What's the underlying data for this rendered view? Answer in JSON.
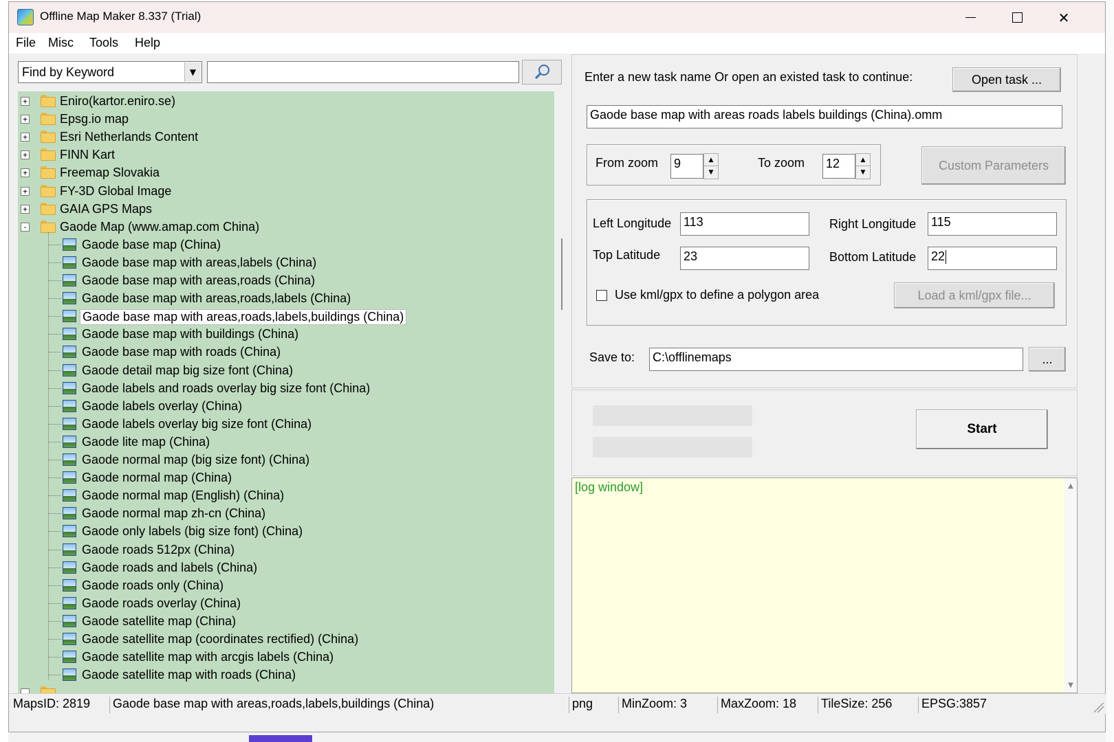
{
  "window": {
    "title": "Offline Map Maker 8.337 (Trial)"
  },
  "menu": [
    "File",
    "Misc",
    "Tools",
    "Help"
  ],
  "search": {
    "mode": "Find by Keyword",
    "query": ""
  },
  "tree": {
    "folders": [
      {
        "label": "Eniro(kartor.eniro.se)",
        "expander": "+"
      },
      {
        "label": "Epsg.io map",
        "expander": "+"
      },
      {
        "label": "Esri Netherlands Content",
        "expander": "+"
      },
      {
        "label": "FINN Kart",
        "expander": "+"
      },
      {
        "label": "Freemap Slovakia",
        "expander": "+"
      },
      {
        "label": "FY-3D Global Image",
        "expander": "+"
      },
      {
        "label": "GAIA GPS Maps",
        "expander": "+"
      },
      {
        "label": "Gaode Map (www.amap.com China)",
        "expander": "-"
      }
    ],
    "children": [
      "Gaode base map (China)",
      "Gaode base map with areas,labels (China)",
      "Gaode base map with areas,roads (China)",
      "Gaode base map with areas,roads,labels (China)",
      "Gaode base map with areas,roads,labels,buildings (China)",
      "Gaode base map with buildings (China)",
      "Gaode base map with roads (China)",
      "Gaode detail map big size font (China)",
      "Gaode labels and roads overlay big size font (China)",
      "Gaode labels overlay (China)",
      "Gaode labels overlay big size font (China)",
      "Gaode lite map (China)",
      "Gaode normal map (big size font) (China)",
      "Gaode normal map (China)",
      "Gaode normal map (English) (China)",
      "Gaode normal map zh-cn (China)",
      "Gaode only labels (big size font) (China)",
      "Gaode roads 512px (China)",
      "Gaode roads and labels (China)",
      "Gaode roads only (China)",
      "Gaode roads overlay (China)",
      "Gaode satellite map (China)",
      "Gaode satellite map (coordinates rectified) (China)",
      "Gaode satellite map with arcgis labels (China)",
      "Gaode satellite map with roads (China)"
    ],
    "selected_index": 4
  },
  "task": {
    "prompt": "Enter a new task name Or open an existed task to continue:",
    "open_button": "Open task ...",
    "name": "Gaode base map with areas roads labels buildings (China).omm"
  },
  "zoom": {
    "from_label": "From zoom",
    "from_value": "9",
    "to_label": "To zoom",
    "to_value": "12",
    "custom_button": "Custom Parameters"
  },
  "area": {
    "left_lon_label": "Left Longitude",
    "left_lon": "113",
    "right_lon_label": "Right Longitude",
    "right_lon": "115",
    "top_lat_label": "Top Latitude",
    "top_lat": "23",
    "bottom_lat_label": "Bottom Latitude",
    "bottom_lat": "22",
    "kml_checkbox_label": "Use kml/gpx to define a polygon area",
    "kml_checked": false,
    "load_kml_button": "Load a kml/gpx file..."
  },
  "save": {
    "label": "Save to:",
    "path": "C:\\offlinemaps",
    "browse_button": "..."
  },
  "actions": {
    "start_button": "Start"
  },
  "log": {
    "text": "[log window]"
  },
  "status": {
    "maps_id": "MapsID: 2819",
    "map_name": "Gaode base map with areas,roads,labels,buildings (China)",
    "format": "png",
    "min_zoom": "MinZoom: 3",
    "max_zoom": "MaxZoom: 18",
    "tile_size": "TileSize: 256",
    "epsg": "EPSG:3857"
  },
  "colors": {
    "tree_background": "#c0dcc0",
    "log_background": "#ffffe1",
    "log_text": "#2e9b2e"
  }
}
